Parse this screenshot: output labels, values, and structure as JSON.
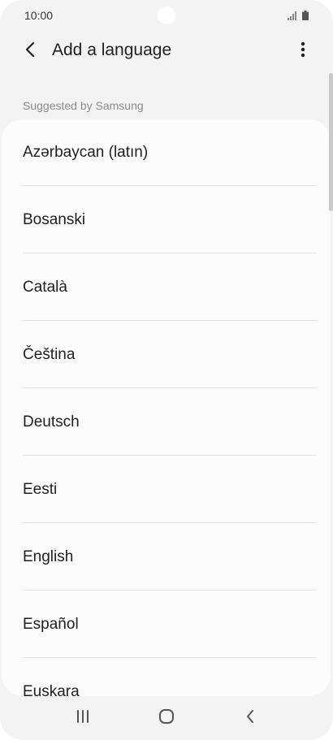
{
  "status_bar": {
    "time": "10:00",
    "signal_icon": "signal-icon",
    "battery_icon": "battery-icon"
  },
  "app_bar": {
    "title": "Add a language",
    "back_icon": "chevron-left-icon",
    "more_icon": "more-vertical-icon"
  },
  "section": {
    "label": "Suggested by Samsung"
  },
  "languages": [
    "Azərbaycan (latın)",
    "Bosanski",
    "Català",
    "Čeština",
    "Deutsch",
    "Eesti",
    "English",
    "Español",
    "Euskara"
  ],
  "nav_bar": {
    "recents_icon": "recents-icon",
    "home_icon": "home-icon",
    "back_icon": "back-icon"
  },
  "colors": {
    "background": "#f3f3f3",
    "card": "#fcfcfc",
    "text": "#1f1f1f",
    "secondary_text": "#8c8c8c"
  }
}
